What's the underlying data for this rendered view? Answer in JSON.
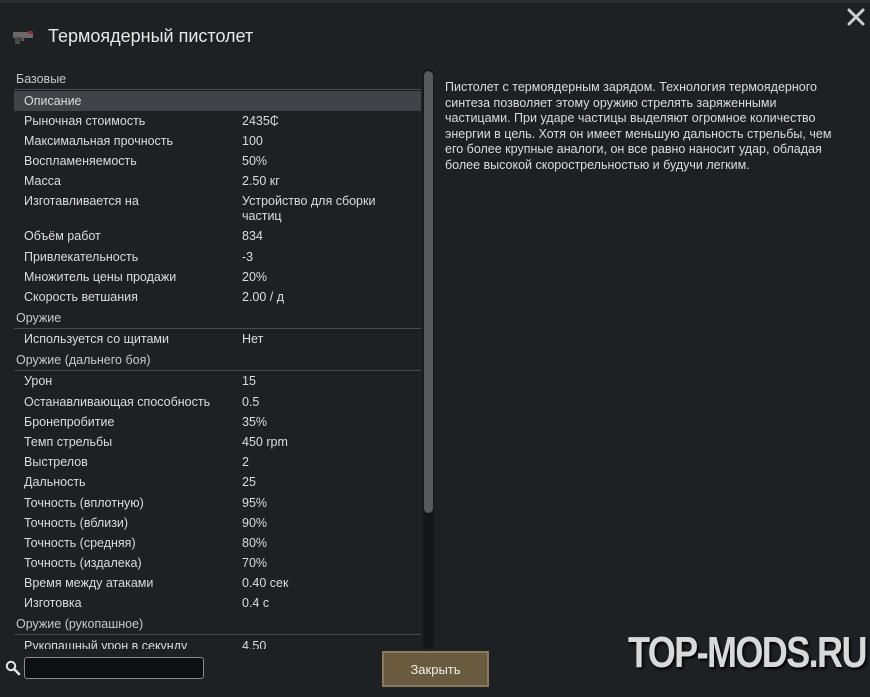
{
  "window": {
    "title": "Термоядерный пистолет"
  },
  "stats": {
    "cat_basic": "Базовые",
    "basic_rows": [
      {
        "label": "Описание",
        "value": ""
      },
      {
        "label": "Рыночная стоимость",
        "value": "2435₵"
      },
      {
        "label": "Максимальная прочность",
        "value": "100"
      },
      {
        "label": "Воспламеняемость",
        "value": "50%"
      },
      {
        "label": "Масса",
        "value": "2.50 кг"
      },
      {
        "label": "Изготавливается на",
        "value": "Устройство для сборки частиц"
      },
      {
        "label": "Объём работ",
        "value": "834"
      },
      {
        "label": "Привлекательность",
        "value": "-3"
      },
      {
        "label": "Множитель цены продажи",
        "value": "20%"
      },
      {
        "label": "Скорость ветшания",
        "value": "2.00 / д"
      }
    ],
    "cat_weapon": "Оружие",
    "weapon_rows": [
      {
        "label": "Используется со щитами",
        "value": "Нет"
      }
    ],
    "cat_ranged": "Оружие (дальнего боя)",
    "ranged_rows": [
      {
        "label": "Урон",
        "value": "15"
      },
      {
        "label": "Останавливающая способность",
        "value": "0.5"
      },
      {
        "label": "Бронепробитие",
        "value": "35%"
      },
      {
        "label": "Темп стрельбы",
        "value": "450 rpm"
      },
      {
        "label": "Выстрелов",
        "value": "2"
      },
      {
        "label": "Дальность",
        "value": "25"
      },
      {
        "label": "Точность (вплотную)",
        "value": "95%"
      },
      {
        "label": "Точность (вблизи)",
        "value": "90%"
      },
      {
        "label": "Точность (средняя)",
        "value": "80%"
      },
      {
        "label": "Точность (издалека)",
        "value": "70%"
      },
      {
        "label": "Время между атаками",
        "value": "0.40 сек"
      },
      {
        "label": "Изготовка",
        "value": "0.4 с"
      }
    ],
    "cat_melee": "Оружие (рукопашное)",
    "melee_rows": [
      {
        "label": "Рукопашный урон в секунду",
        "value": "4.50"
      }
    ]
  },
  "description": "Пистолет с термоядерным зарядом. Технология термоядерного синтеза позволяет этому оружию стрелять заряженными частицами. При ударе частицы выделяют огромное количество энергии в цель. Хотя он имеет меньшую дальность стрельбы, чем его более крупные аналоги, он все равно наносит удар, обладая более высокой скорострельностью и будучи легким.",
  "search": {
    "value": "",
    "placeholder": ""
  },
  "buttons": {
    "close_label": "Закрыть"
  },
  "watermark": {
    "text": "TOP-MODS.RU"
  },
  "colors": {
    "background": "#1e2124",
    "selected_row": "#404347",
    "button": "#6b5b3e"
  },
  "icons": [
    "pistol-icon",
    "close-icon",
    "search-icon"
  ],
  "scroll": {
    "visible_fraction": 0.76,
    "position_fraction": 0.0
  }
}
